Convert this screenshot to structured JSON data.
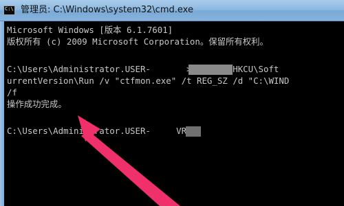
{
  "window": {
    "icon_text": "C:\\",
    "title": "管理员: C:\\Windows\\system32\\cmd.exe"
  },
  "console": {
    "lines": [
      "Microsoft Windows [版本 6.1.7601]",
      "版权所有 (c) 2009 Microsoft Corporation。保留所有权利。",
      "",
      "C:\\Users\\Administrator.USER-       >reg add HKCU\\Soft",
      "urrentVersion\\Run /v \"ctfmon.exe\" /t REG_SZ /d \"C:\\WIND",
      "/f",
      "操作成功完成。",
      "",
      "C:\\Users\\Administrator.USER-     VR>"
    ]
  },
  "annotation": {
    "arrow_color": "#f0306a"
  }
}
